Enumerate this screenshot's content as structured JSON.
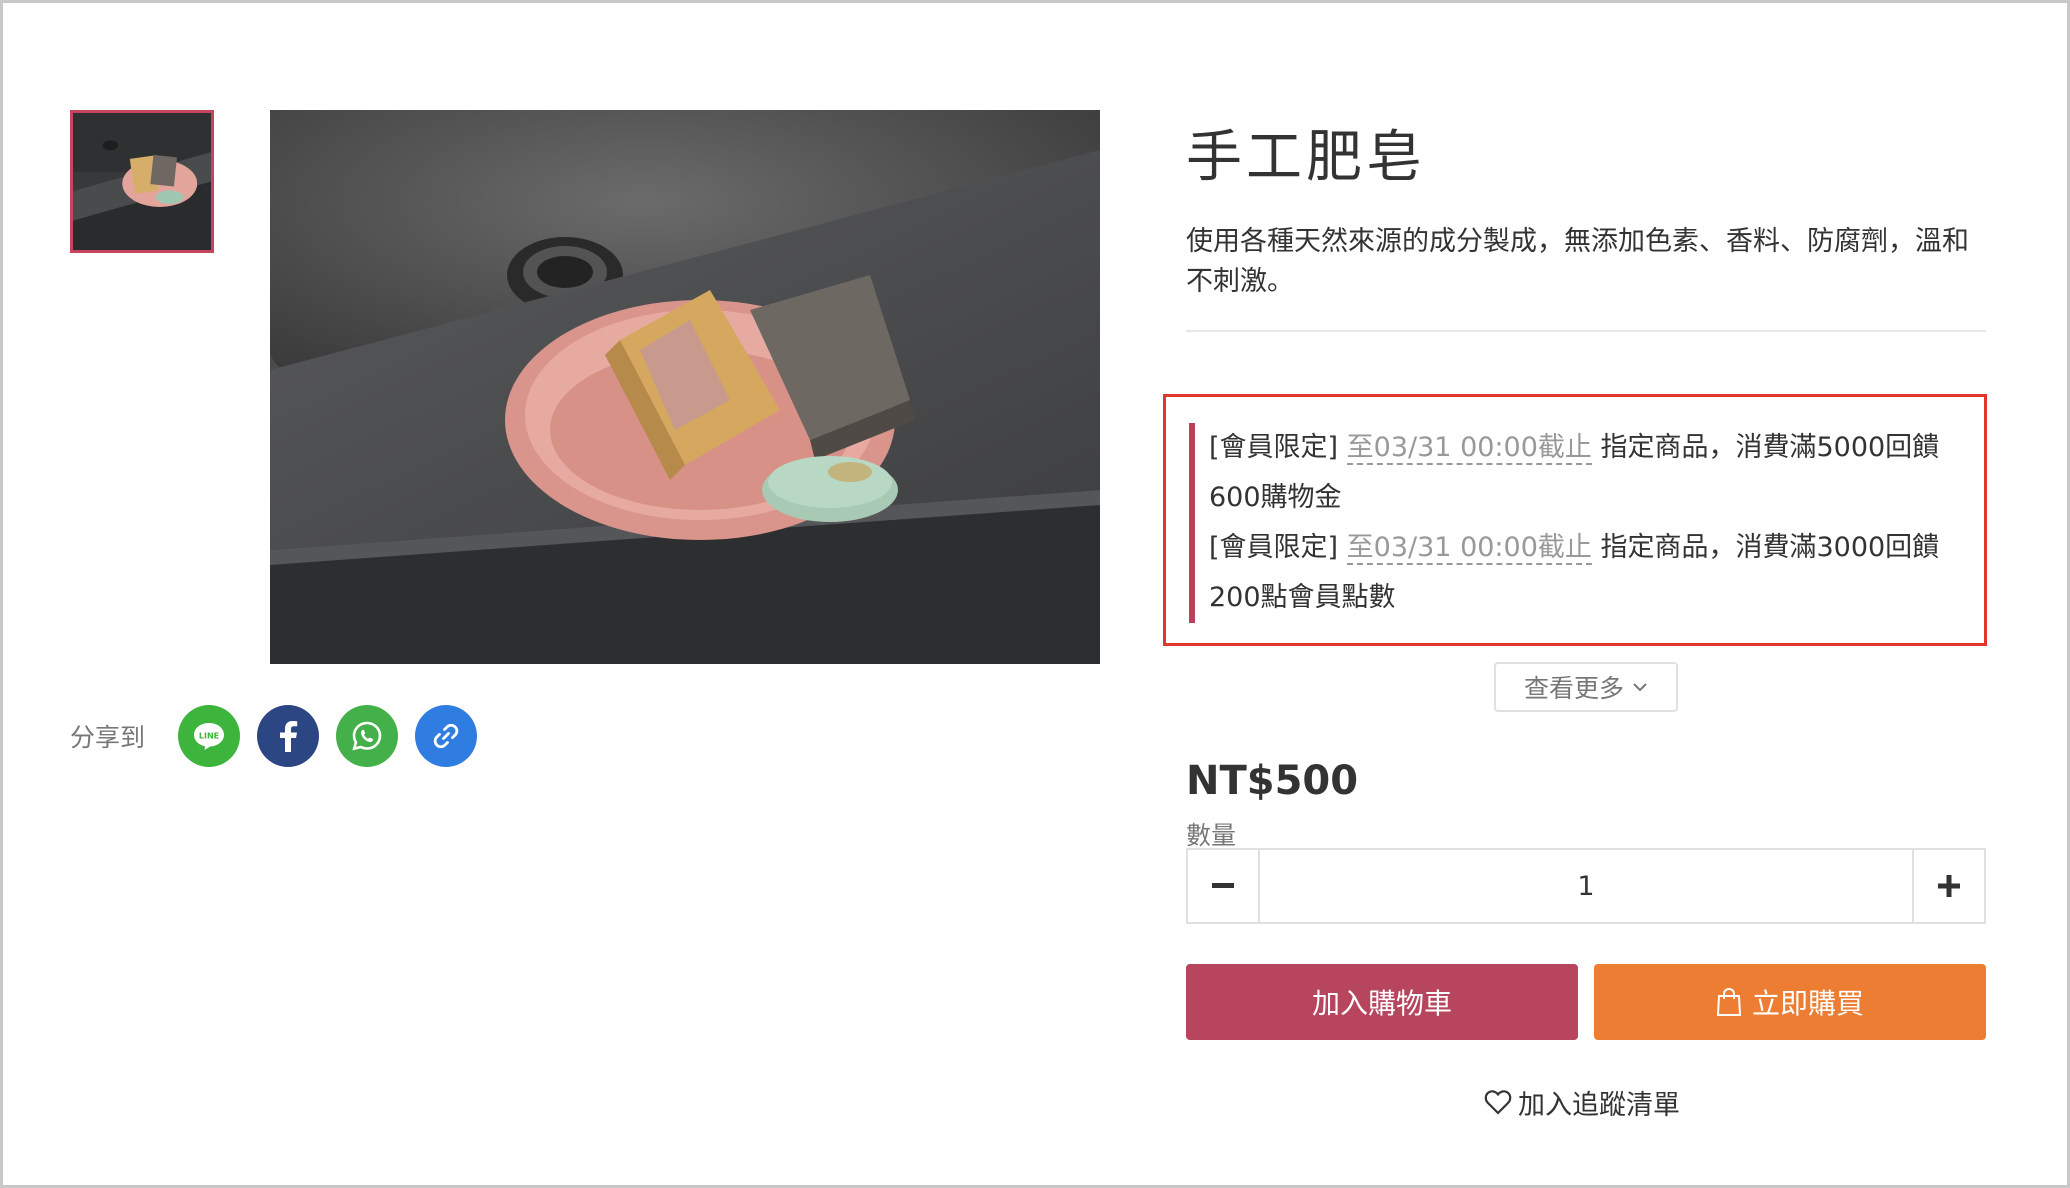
{
  "product": {
    "title": "手工肥皂",
    "description": "使用各種天然來源的成分製成，無添加色素、香料、防腐劑，溫和不刺激。",
    "price": "NT$500"
  },
  "share": {
    "label": "分享到",
    "buttons": [
      {
        "name": "line",
        "icon": "line-icon",
        "text": "LINE",
        "color": "#3db43b"
      },
      {
        "name": "facebook",
        "icon": "facebook-icon",
        "color": "#2c4583"
      },
      {
        "name": "whatsapp",
        "icon": "whatsapp-icon",
        "color": "#43b049"
      },
      {
        "name": "copy-link",
        "icon": "link-icon",
        "color": "#2f7de0"
      }
    ]
  },
  "promotions": [
    {
      "tag": "[會員限定]",
      "deadline": "至03/31 00:00截止",
      "text_line1": "指定商品，消費滿5000回饋",
      "text_line2": "600購物金"
    },
    {
      "tag": "[會員限定]",
      "deadline": "至03/31 00:00截止",
      "text_line1": "指定商品，消費滿3000回饋",
      "text_line2": "200點會員點數"
    }
  ],
  "more_button": {
    "label": "查看更多",
    "icon": "chevron-down-icon"
  },
  "quantity": {
    "label": "數量",
    "value": "1",
    "minus_icon": "minus-icon",
    "plus_icon": "plus-icon"
  },
  "actions": {
    "add_to_cart": "加入購物車",
    "buy_now": "立即購買",
    "buy_now_icon": "shopping-bag-icon",
    "wishlist": "加入追蹤清單",
    "wishlist_icon": "heart-icon"
  },
  "colors": {
    "accent": "#b8455e",
    "buy": "#ec7d33",
    "highlight_border": "#e0362b"
  }
}
